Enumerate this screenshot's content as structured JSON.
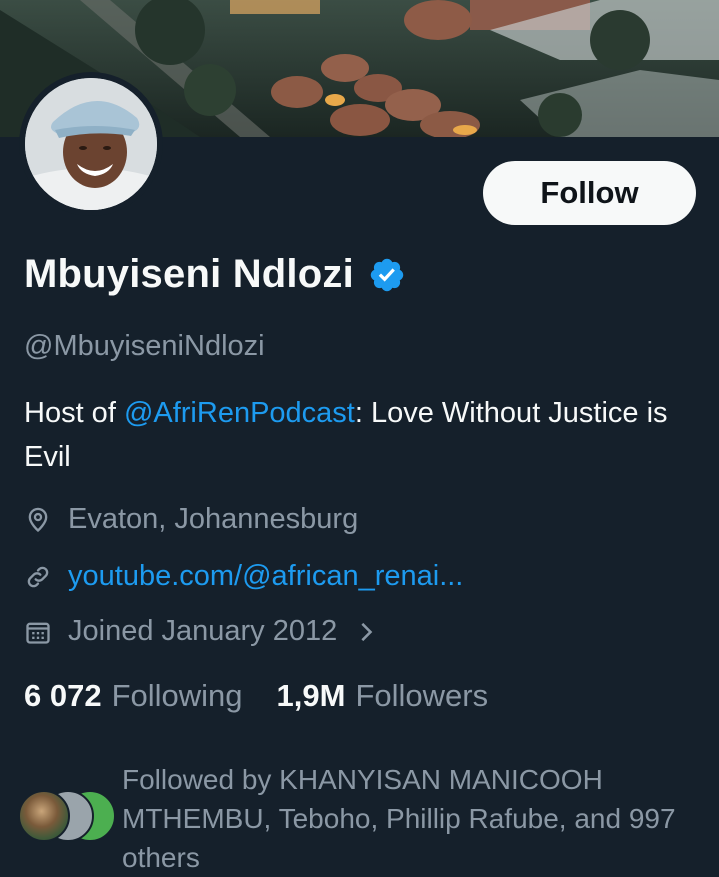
{
  "profile": {
    "name": "Mbuyiseni Ndlozi",
    "handle": "@MbuyiseniNdlozi",
    "follow_label": "Follow",
    "bio_prefix": "Host of ",
    "bio_mention": "@AfriRenPodcast",
    "bio_suffix": ": Love Without Justice is Evil",
    "location": "Evaton, Johannesburg",
    "website": "youtube.com/@african_renai...",
    "joined": "Joined January 2012",
    "following_count": "6 072",
    "following_label": "Following",
    "followers_count": "1,9M",
    "followers_label": "Followers",
    "followed_by": "Followed by KHANYISAN MANICOOH MTHEMBU, Teboho, Phillip Rafube, and 997 others"
  },
  "icons": {
    "verified": "verified-badge-icon",
    "location": "location-pin-icon",
    "link": "link-icon",
    "calendar": "calendar-icon",
    "chevron": "chevron-right-icon"
  },
  "colors": {
    "background": "#15202b",
    "accent": "#1d9bf0",
    "text_primary": "#f7f9f9",
    "text_secondary": "#8b98a5",
    "button_bg": "#f7f9f9",
    "button_text": "#0f1419"
  }
}
